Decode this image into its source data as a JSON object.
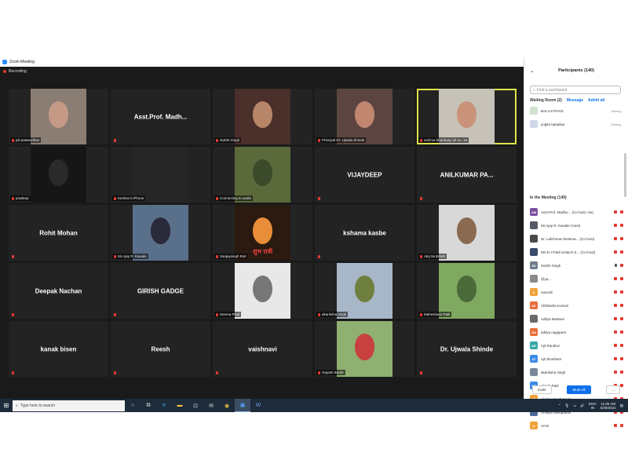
{
  "window": {
    "title": "Zoom Meeting",
    "minimize": "–",
    "maximize": "▢",
    "close": "✕"
  },
  "recording": "Recording",
  "tiles": [
    {
      "label": "juli patwardhan",
      "type": "video",
      "bg": "#8a7d73",
      "skin": "#c49a86"
    },
    {
      "name": "Asst.Prof. Madh...",
      "type": "name"
    },
    {
      "label": "Sukriti Singh",
      "type": "video",
      "bg": "#4a2f2a",
      "skin": "#b78568"
    },
    {
      "label": "Principal Dr. Ujwala Shinde",
      "type": "video",
      "bg": "#5c4540",
      "skin": "#c08670"
    },
    {
      "label": "ashima bhardwaj roll no. 18",
      "type": "video",
      "bg": "#c7c2b8",
      "skin": "#c9937a",
      "active": true
    },
    {
      "label": "pradeep",
      "type": "video",
      "bg": "#161616",
      "skin": "#2a2a2a"
    },
    {
      "label": "Keshav's iPhone",
      "type": "video",
      "bg": "#262626",
      "skin": "#262626"
    },
    {
      "label": "Connecting to audio",
      "type": "video",
      "bg": "#5c6a3b",
      "skin": "#3b4a2a"
    },
    {
      "name": "VIJAYDEEP",
      "type": "name"
    },
    {
      "name": "ANILKUMAR PA...",
      "type": "name"
    },
    {
      "name": "Rohit Mohan",
      "type": "name"
    },
    {
      "label": "Mr.Ajay R. Kawale",
      "type": "video",
      "bg": "#5a6f8a",
      "skin": "#2a2a3a"
    },
    {
      "label": "Sanjaysingh Bist",
      "type": "video",
      "bg": "#2a1a10",
      "skin": "#e88e3a",
      "caption": "शुभ रात्री"
    },
    {
      "name": "kshama kasbe",
      "type": "name"
    },
    {
      "label": "Atiq Nirdshah",
      "type": "video",
      "bg": "#d8d8d8",
      "skin": "#8a6a50"
    },
    {
      "name": "Deepak Nachan",
      "type": "name"
    },
    {
      "name": "GIRISH GADGE",
      "type": "name"
    },
    {
      "label": "Seema Pisal",
      "type": "video",
      "bg": "#e8e8e8",
      "skin": "#777777"
    },
    {
      "label": "akanksha singh",
      "type": "video",
      "bg": "#a7b7c7",
      "skin": "#6f7f3f"
    },
    {
      "label": "Maheshwar Patil",
      "type": "video",
      "bg": "#7fa860",
      "skin": "#4a6a3a"
    },
    {
      "name": "kanak bisen",
      "type": "name"
    },
    {
      "name": "Reesh",
      "type": "name"
    },
    {
      "name": "vaishnavi",
      "type": "name"
    },
    {
      "label": "Gayatri Burde",
      "type": "video",
      "bg": "#8fb070",
      "skin": "#c84040"
    },
    {
      "name": "Dr. Ujwala Shinde",
      "type": "name"
    }
  ],
  "participants": {
    "title": "Participants (140)",
    "search_placeholder": "Find a participant",
    "waiting_room": "Waiting Room (2)",
    "message": "Message",
    "admit_all": "Admit all",
    "waiting": [
      {
        "name": "BALAJI PHAD",
        "status": "Joining...",
        "color": "#cfe3cf"
      },
      {
        "name": "yogita tapadiya",
        "status": "Joining...",
        "color": "#cfd8e8"
      }
    ],
    "in_meeting": "In the Meeting (140)",
    "list": [
      {
        "initials": "AM",
        "name": "Asst.Prof. Madhu... (Co-host, me)",
        "color": "#7b4fa0"
      },
      {
        "initials": "",
        "name": "Mr.Ajay R. Kawale (Host)",
        "color": "#555a66"
      },
      {
        "initials": "",
        "name": "Dr. Lalichman Brahma... (Co-host)",
        "color": "#4a4a4a"
      },
      {
        "initials": "",
        "name": "DR.D.Y.Patil Unitech S... (Co-host)",
        "color": "#3a4a6a"
      },
      {
        "initials": "SS",
        "name": "Sukriti Singh",
        "color": "#6f7f8f"
      },
      {
        "initials": "",
        "name": "@ya...",
        "color": "#8a8a8a"
      },
      {
        "initials": "A",
        "name": "Aarushi",
        "color": "#f2a33a"
      },
      {
        "initials": "AK",
        "name": "Abhilasha Kumari",
        "color": "#e86f3a"
      },
      {
        "initials": "",
        "name": "Aditya Madane",
        "color": "#6a6a6a"
      },
      {
        "initials": "AN",
        "name": "aditya nagapure",
        "color": "#e86f3a"
      },
      {
        "initials": "AR",
        "name": "Ajit Randive",
        "color": "#3aa8a8"
      },
      {
        "initials": "AT",
        "name": "Ajit thombare",
        "color": "#3a8ae8"
      },
      {
        "initials": "",
        "name": "akanksha singh",
        "color": "#7a8a9a"
      },
      {
        "initials": "AP",
        "name": "Akash Patil",
        "color": "#3a8ae8"
      },
      {
        "initials": "AD",
        "name": "Akshay Deshpande",
        "color": "#f2a33a"
      },
      {
        "initials": "",
        "name": "Ameya Deshpande",
        "color": "#4a6a9a"
      },
      {
        "initials": "A",
        "name": "Amin",
        "color": "#f2a33a"
      }
    ],
    "invite": "Invite",
    "mute_all": "Mute All",
    "more": "..."
  },
  "taskbar": {
    "search_placeholder": "Type here to search",
    "lang1": "ENG",
    "lang2": "IN",
    "time": "11:06 AM",
    "date": "6/28/2021"
  },
  "colors": {
    "accent": "#0e71eb",
    "active_speaker": "#dfe64a",
    "muted": "#e53935"
  }
}
